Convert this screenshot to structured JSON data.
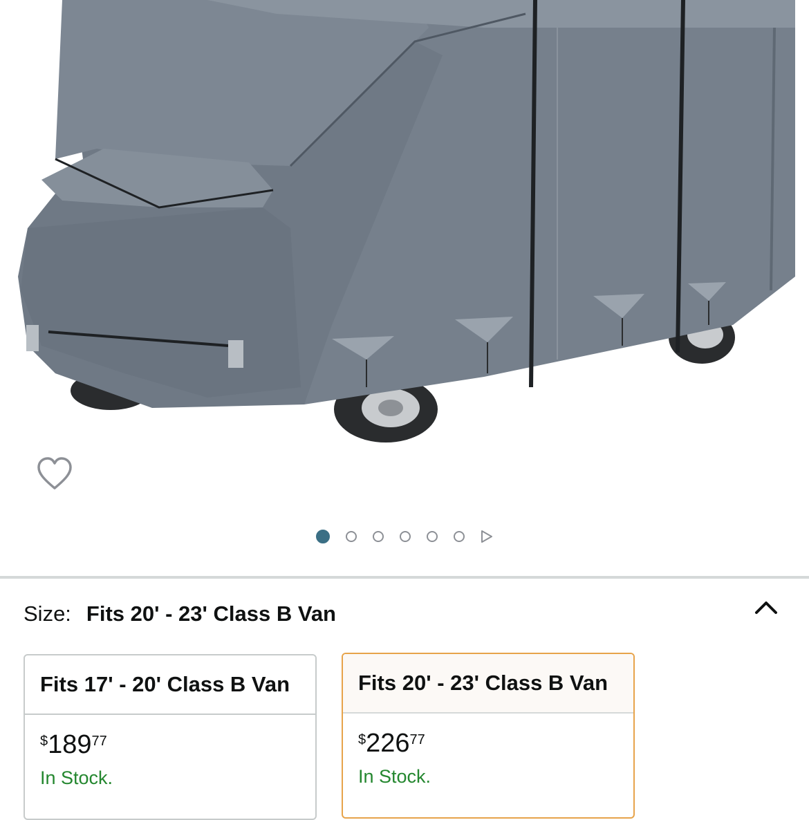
{
  "gallery": {
    "image_alt": "Gray RV cover on a Class B camper van",
    "dots_total": 6,
    "active_index": 0,
    "colors": {
      "active_dot": "#3b6f85",
      "inactive_dot": "#8d9096"
    },
    "icons": {
      "wishlist": "heart-outline-icon",
      "next": "play-triangle-icon"
    }
  },
  "size_selector": {
    "label": "Size:",
    "selected_value": "Fits 20' - 23' Class B Van",
    "toggle_icon": "chevron-up-icon",
    "options": [
      {
        "title": "Fits 17' - 20' Class B Van",
        "currency": "$",
        "price_whole": "189",
        "price_fraction": "77",
        "availability": "In Stock.",
        "selected": false
      },
      {
        "title": "Fits 20' - 23' Class B Van",
        "currency": "$",
        "price_whole": "226",
        "price_fraction": "77",
        "availability": "In Stock.",
        "selected": true
      }
    ],
    "colors": {
      "selected_border": "#e7a34a",
      "in_stock": "#24872f"
    }
  }
}
